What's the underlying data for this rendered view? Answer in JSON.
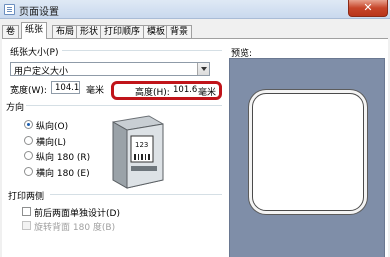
{
  "window": {
    "title": "页面设置",
    "close_glyph": "✕"
  },
  "tabs": [
    {
      "label": "卷"
    },
    {
      "label": "纸张"
    },
    {
      "label": "布局"
    },
    {
      "label": "形状"
    },
    {
      "label": "打印顺序"
    },
    {
      "label": "模板"
    },
    {
      "label": "背景"
    }
  ],
  "active_tab": "纸张",
  "paper_size": {
    "group_label": "纸张大小(P)",
    "selected": "用户定义大小",
    "width_label": "宽度(W):",
    "width_value": "104.1",
    "width_unit": "毫米",
    "height_label": "高度(H):",
    "height_value": "101.6",
    "height_unit": "毫米"
  },
  "orientation": {
    "group_label": "方向",
    "options": [
      {
        "label": "纵向(O)",
        "checked": true
      },
      {
        "label": "横向(L)",
        "checked": false
      },
      {
        "label": "纵向 180 (R)",
        "checked": false
      },
      {
        "label": "横向 180 (E)",
        "checked": false
      }
    ],
    "printer_illustration_label": "123"
  },
  "duplex": {
    "group_label": "打印两侧",
    "options": [
      {
        "label": "前后两面单独设计(D)",
        "checked": false,
        "disabled": false
      },
      {
        "label": "旋转背面 180 度(B)",
        "checked": false,
        "disabled": true
      }
    ]
  },
  "preview": {
    "label": "预览:"
  },
  "colors": {
    "highlight": "#c0141a",
    "preview_bg": "#7f8ea8",
    "title_bar": "#c9d9ee"
  }
}
